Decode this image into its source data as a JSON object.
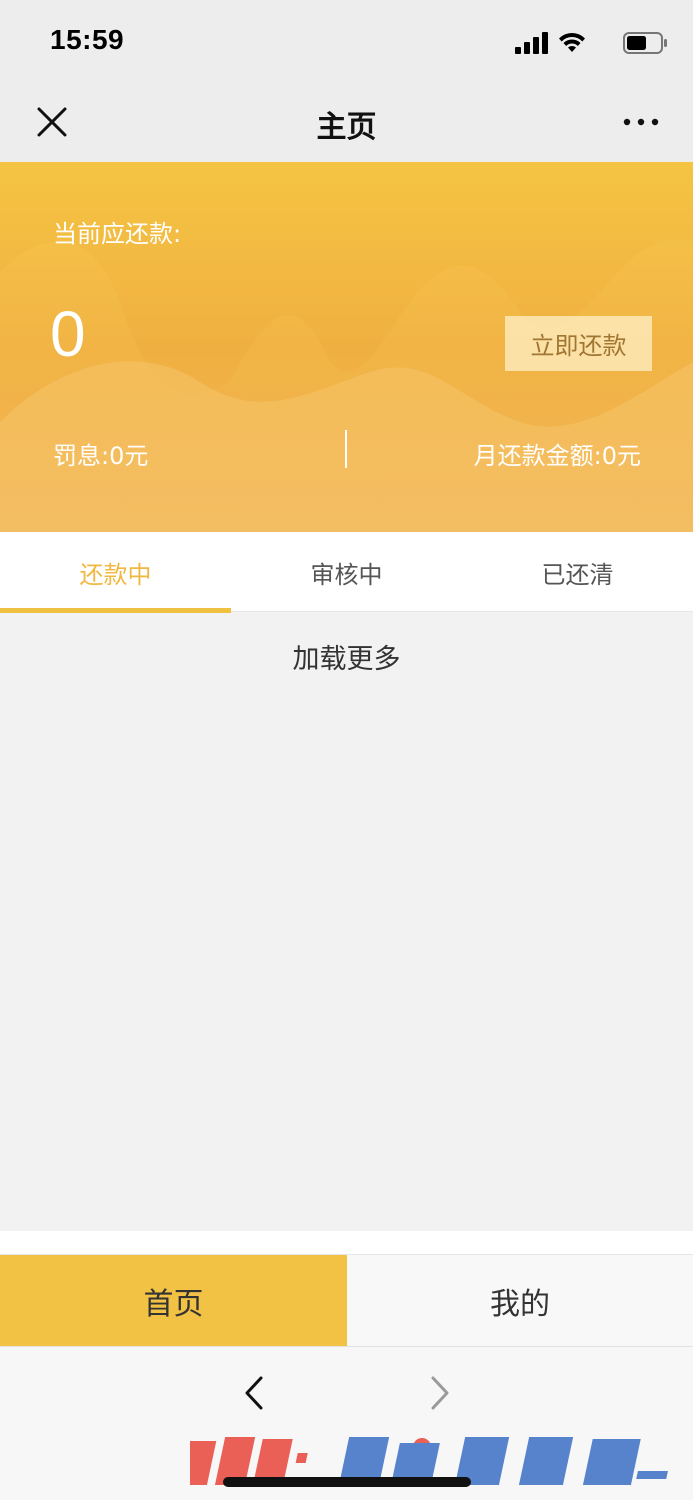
{
  "status_bar": {
    "time": "15:59"
  },
  "nav": {
    "title": "主页"
  },
  "hero": {
    "label": "当前应还款:",
    "amount": "0",
    "repay_button": "立即还款",
    "penalty": "罚息:0元",
    "monthly": "月还款金额:0元"
  },
  "tabs": [
    {
      "label": "还款中",
      "active": true
    },
    {
      "label": "审核中",
      "active": false
    },
    {
      "label": "已还清",
      "active": false
    }
  ],
  "content": {
    "load_more": "加载更多"
  },
  "bottom_tabs": [
    {
      "label": "首页",
      "active": true
    },
    {
      "label": "我的",
      "active": false
    }
  ],
  "colors": {
    "accent": "#f2c244",
    "active_tab_text": "#f0b840",
    "hero_top": "#f5c443",
    "hero_bottom": "#f0b35a"
  },
  "icons": {
    "close": "close-icon",
    "more": "more-icon",
    "back": "chevron-left-icon",
    "forward": "chevron-right-icon"
  }
}
